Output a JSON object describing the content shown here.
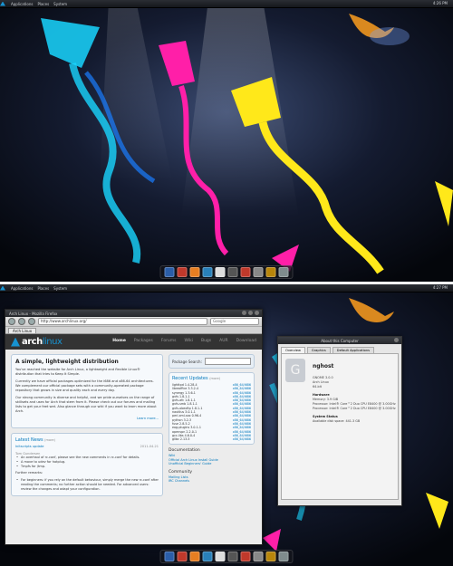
{
  "top_screen": {
    "panel": {
      "menu": [
        "Applications",
        "Places",
        "System"
      ],
      "clock": "4:26 PM"
    },
    "dock_icons": [
      "browser-icon",
      "terminal-icon",
      "files-icon",
      "chat-icon",
      "media-icon",
      "settings-icon",
      "trash-icon",
      "image-icon",
      "music-icon",
      "app-icon"
    ]
  },
  "bottom_screen": {
    "panel": {
      "menu": [
        "Applications",
        "Places",
        "System"
      ],
      "clock": "4:27 PM"
    },
    "browser": {
      "window_title": "Arch Linux - Mozilla Firefox",
      "url": "http://www.archlinux.org/",
      "search_placeholder": "Google",
      "tab_label": "Arch Linux",
      "site": {
        "logo_main": "arch",
        "logo_sub": "linux",
        "nav": [
          "Home",
          "Packages",
          "Forums",
          "Wiki",
          "Bugs",
          "AUR",
          "Download"
        ],
        "intro_title": "A simple, lightweight distribution",
        "intro_text": [
          "You've reached the website for Arch Linux, a lightweight and flexible Linux® distribution that tries to Keep It Simple.",
          "Currently we have official packages optimized for the i686 and x86-64 architectures. We complement our official package sets with a community-operated package repository that grows in size and quality each and every day.",
          "Our strong community is diverse and helpful, and we pride ourselves on the range of skillsets and uses for Arch that stem from it. Please check out our forums and mailing lists to get your feet wet. Also glance through our wiki if you want to learn more about Arch."
        ],
        "learn_more": "Learn more...",
        "news_title": "Latest News",
        "news_rss": "(more)",
        "news_item_title": "Initscripts update",
        "news_item_date": "2011-04-21",
        "news_author": "Tom Gundersen",
        "news_bullets": [
          "An overhaul of rc.conf, please see the new comments in rc.conf for details.",
          "A move to udev for hotplug.",
          "Tmpfs for /tmp."
        ],
        "news_more": "Further remarks:",
        "news_paragraph": "For beginners: if you rely on the default behaviour, simply merge the new rc.conf after reading the comments; no further action should be needed. For advanced users: review the changes and adapt your configuration."
      },
      "sidebar": {
        "package_search_label": "Package Search:",
        "updates_title": "Recent Updates",
        "updates_more": "(more)",
        "updates": [
          {
            "name": "lighttpd 1.4.28-4",
            "arch": "x86_64/i686"
          },
          {
            "name": "libreoffice 3.3.2-4",
            "arch": "x86_64/i686"
          },
          {
            "name": "synergy 1.3.6-1",
            "arch": "x86_64/i686"
          },
          {
            "name": "gvfs 1.8.1-1",
            "arch": "x86_64/i686"
          },
          {
            "name": "gvfs-afc 1.8.1-1",
            "arch": "x86_64/i686"
          },
          {
            "name": "gvfs-smb 1.8.1-1",
            "arch": "x86_64/i686"
          },
          {
            "name": "gvfs-obexftp 1.8.1-1",
            "arch": "x86_64/i686"
          },
          {
            "name": "nautilus 3.0.1-1",
            "arch": "x86_64/i686"
          },
          {
            "name": "perl-xml-sax 0.96-4",
            "arch": "x86_64/i686"
          },
          {
            "name": "python 3.2-3",
            "arch": "x86_64/i686"
          },
          {
            "name": "fuse 2.8.5-2",
            "arch": "x86_64/i686"
          },
          {
            "name": "eog-plugins 3.0.1-1",
            "arch": "x86_64/i686"
          },
          {
            "name": "openvpn 2.2.0-1",
            "arch": "x86_64/i686"
          },
          {
            "name": "gcc-libs 4.6.0-4",
            "arch": "x86_64/i686"
          },
          {
            "name": "glibc 2.13-5",
            "arch": "x86_64/i686"
          }
        ],
        "doc_title": "Documentation",
        "doc_links": [
          "Wiki",
          "Official Arch Linux Install Guide",
          "Unofficial Beginners' Guide"
        ],
        "community_title": "Community",
        "community_links": [
          "Mailing Lists",
          "IRC Channels"
        ]
      }
    },
    "about": {
      "window_title": "About this Computer",
      "tabs": [
        "Overview",
        "Graphics",
        "Default Applications"
      ],
      "hostname": "nghost",
      "logo_letter": "G",
      "info_lines": [
        "GNOME 3.0.0",
        "Arch Linux",
        "64-bit"
      ],
      "hardware_title": "Hardware",
      "hardware": [
        "Memory: 3.9 GiB",
        "Processor: Intel® Core™2 Duo CPU E8400 @ 3.00GHz",
        "Processor: Intel® Core™2 Duo CPU E8400 @ 3.00GHz"
      ],
      "system_title": "System Status",
      "system": [
        "Available disk space: 441.3 GB"
      ]
    },
    "dock_icons": [
      "browser-icon",
      "terminal-icon",
      "files-icon",
      "chat-icon",
      "media-icon",
      "settings-icon",
      "trash-icon",
      "image-icon",
      "music-icon",
      "app-icon"
    ]
  },
  "colors": {
    "arch_blue": "#1793d1",
    "kite_cyan": "#19d6ff",
    "kite_magenta": "#ff1fa8",
    "kite_yellow": "#ffe81a"
  }
}
